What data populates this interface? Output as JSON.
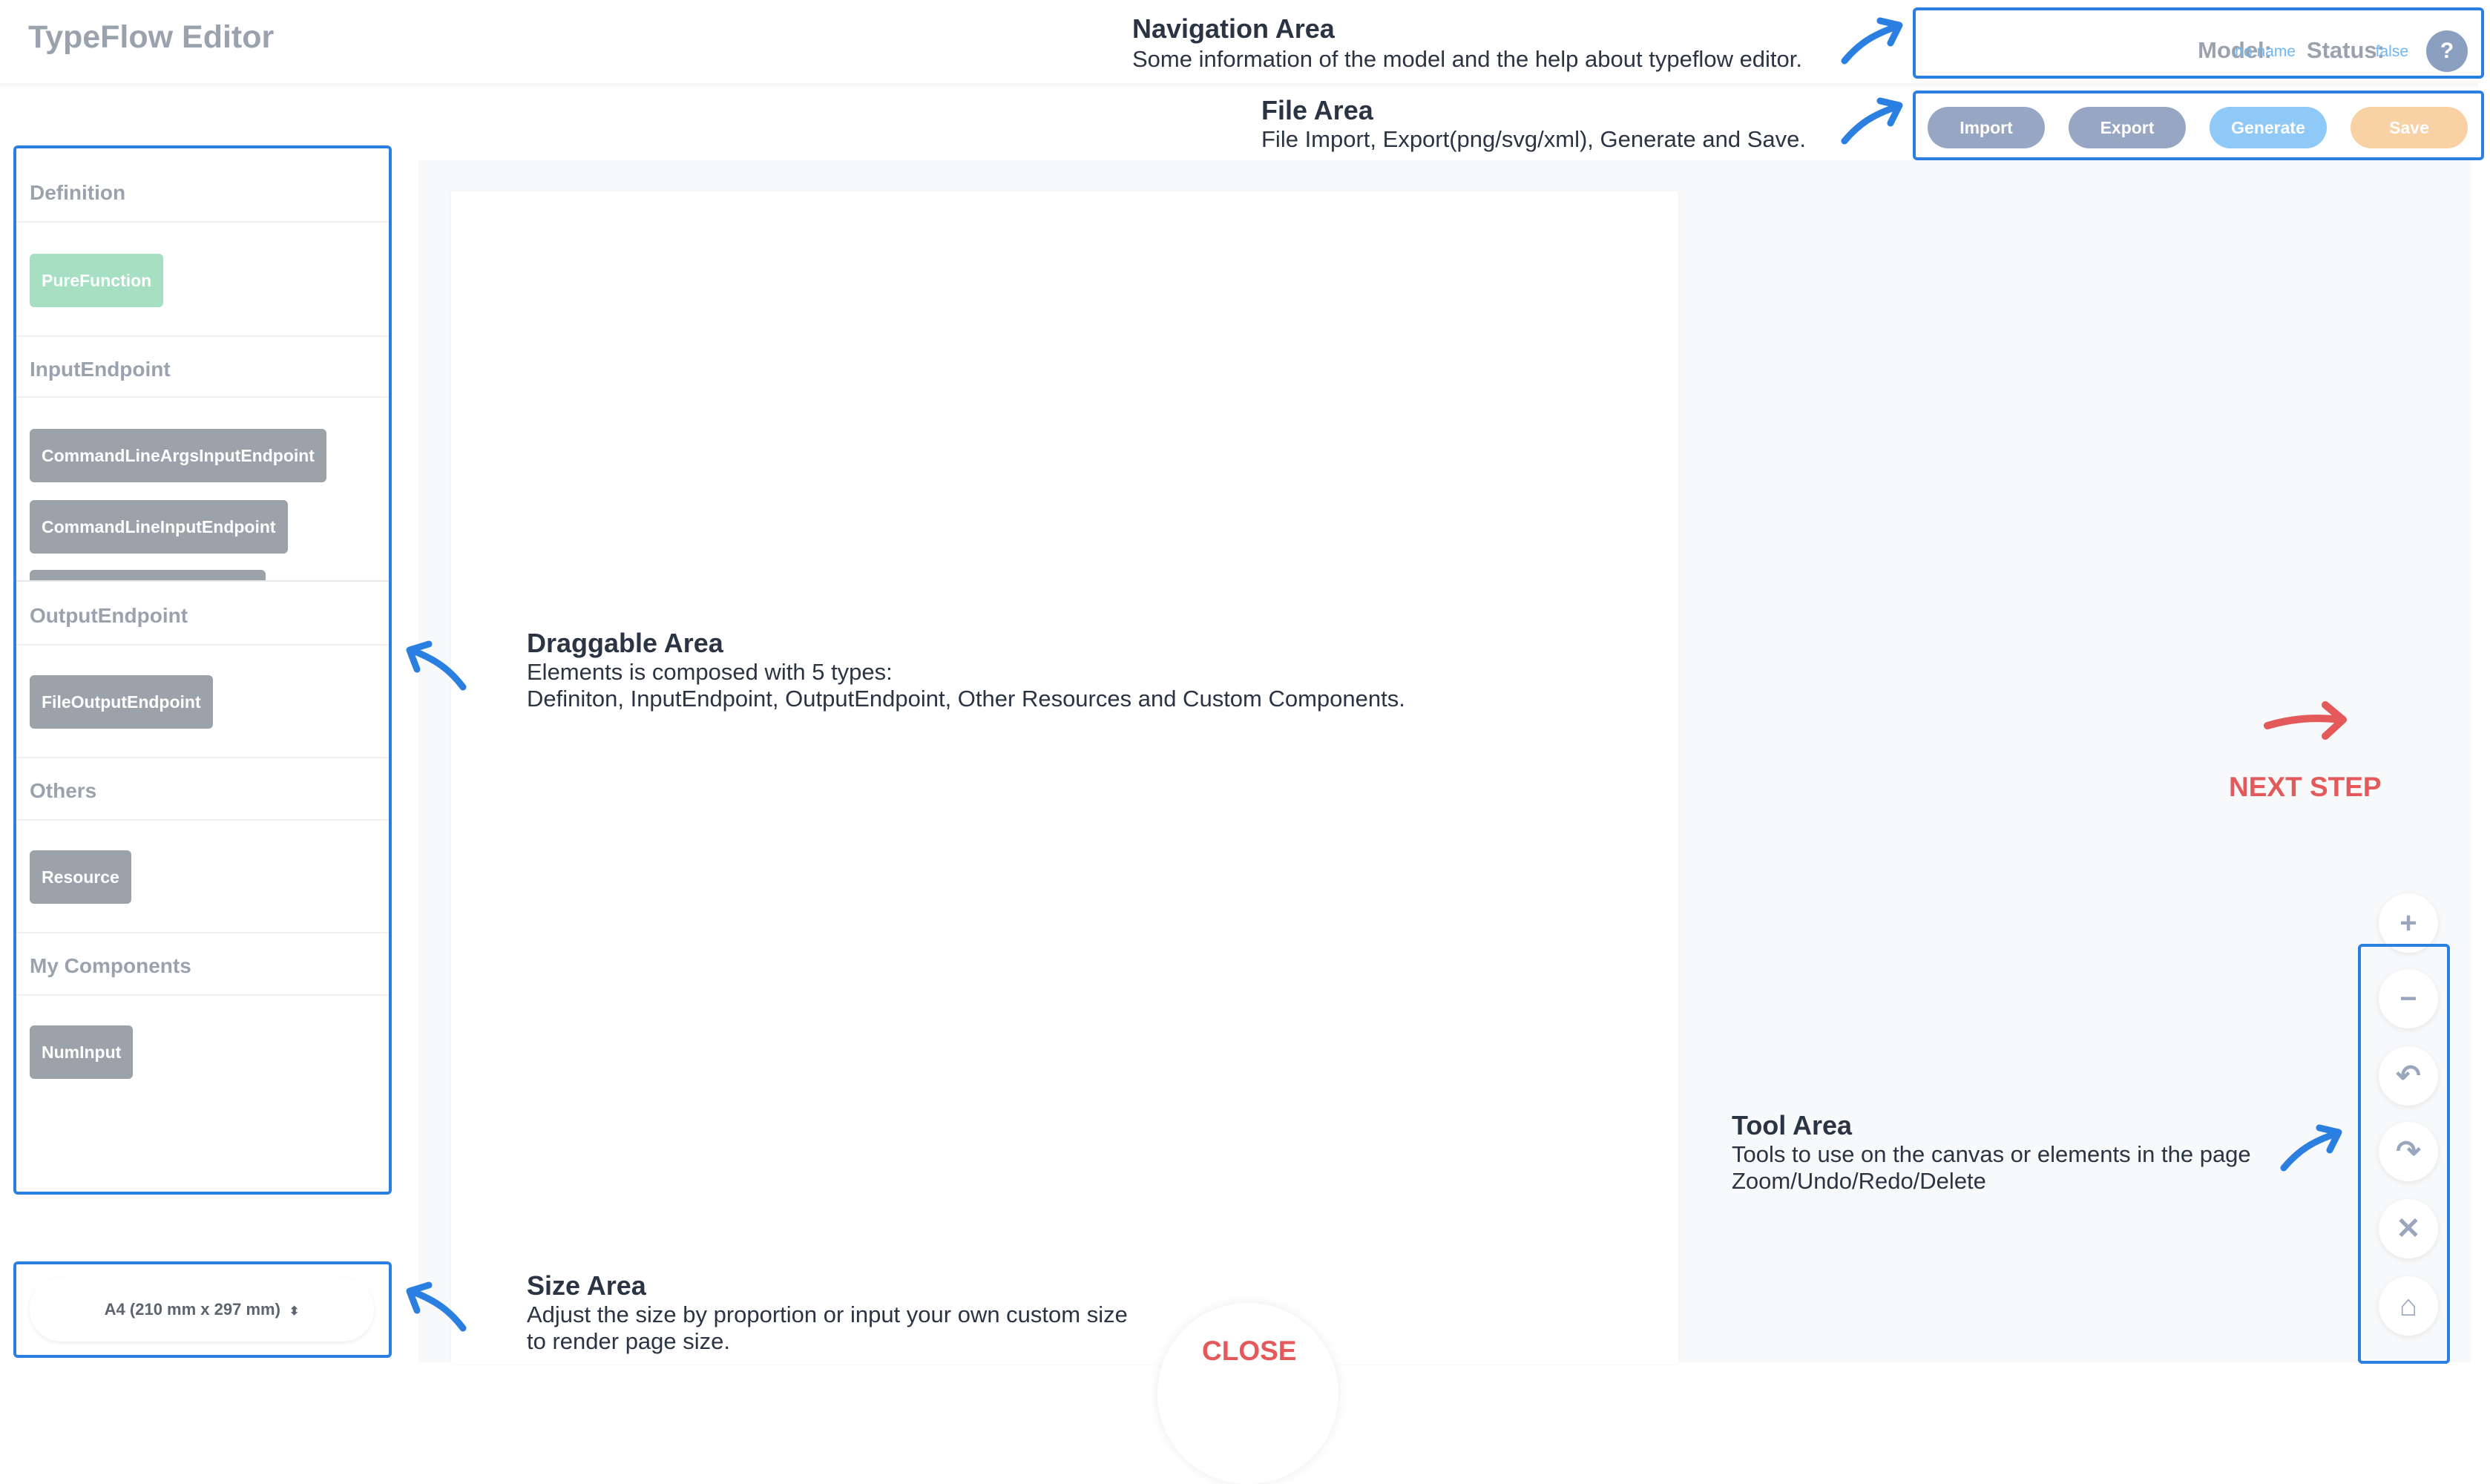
{
  "app": {
    "title": "TypeFlow Editor"
  },
  "nav": {
    "model_label": "Model:",
    "model_value": "no name",
    "status_label": "Status:",
    "status_value": "false",
    "help_icon": "?"
  },
  "file": {
    "import": "Import",
    "export": "Export",
    "generate": "Generate",
    "save": "Save"
  },
  "annotations": {
    "navigation": {
      "title": "Navigation Area",
      "lines": [
        "Some information of the model and the help about typeflow editor."
      ]
    },
    "file": {
      "title": "File Area",
      "lines": [
        "File Import, Export(png/svg/xml), Generate and Save."
      ]
    },
    "draggable": {
      "title": "Draggable Area",
      "lines": [
        "Elements is composed with 5 types:",
        "Definiton, InputEndpoint, OutputEndpoint, Other Resources and Custom Components."
      ]
    },
    "tool": {
      "title": "Tool Area",
      "lines": [
        "Tools to use on the canvas or elements in the page",
        "Zoom/Undo/Redo/Delete"
      ]
    },
    "size": {
      "title": "Size Area",
      "lines": [
        "Adjust the size by proportion or input your own custom size",
        "to render page size."
      ]
    }
  },
  "sidebar": {
    "sections": [
      {
        "title": "Definition",
        "items": [
          "PureFunction"
        ]
      },
      {
        "title": "InputEndpoint",
        "items": [
          "CommandLineArgsInputEndpoint",
          "CommandLineInputEndpoint"
        ]
      },
      {
        "title": "OutputEndpoint",
        "items": [
          "FileOutputEndpoint"
        ]
      },
      {
        "title": "Others",
        "items": [
          "Resource"
        ]
      },
      {
        "title": "My Components",
        "items": [
          "NumInput"
        ]
      }
    ]
  },
  "size": {
    "value": "A4 (210 mm x 297 mm)"
  },
  "tools": [
    {
      "icon": "zoom-in-icon",
      "glyph": "+"
    },
    {
      "icon": "zoom-out-icon",
      "glyph": "−"
    },
    {
      "icon": "undo-icon",
      "glyph": "↶"
    },
    {
      "icon": "redo-icon",
      "glyph": "↷"
    },
    {
      "icon": "delete-icon",
      "glyph": "✕"
    },
    {
      "icon": "clear-icon",
      "glyph": "⌂"
    }
  ],
  "next_step": "NEXT STEP",
  "close": "CLOSE",
  "colors": {
    "accent_blue": "#2b7fe0",
    "accent_red": "#e45a5a"
  }
}
